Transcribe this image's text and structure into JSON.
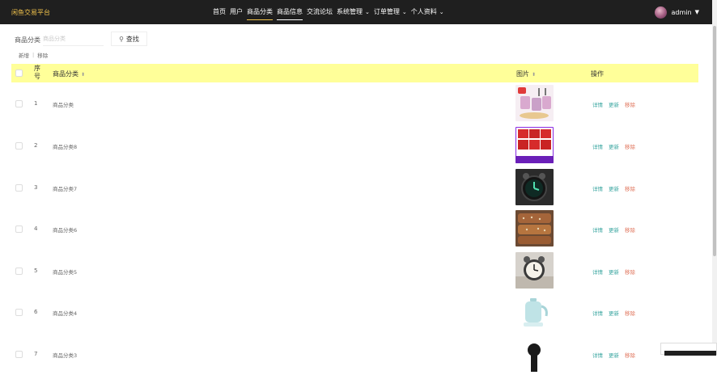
{
  "header": {
    "brand": "闲鱼交易平台",
    "menu": [
      {
        "label": "首页",
        "has_dropdown": false,
        "state": "normal"
      },
      {
        "label": "用户",
        "has_dropdown": false,
        "state": "normal"
      },
      {
        "label": "商品分类",
        "has_dropdown": false,
        "state": "active"
      },
      {
        "label": "商品信息",
        "has_dropdown": false,
        "state": "hover"
      },
      {
        "label": "交流论坛",
        "has_dropdown": false,
        "state": "normal"
      },
      {
        "label": "系统管理",
        "has_dropdown": true,
        "state": "normal"
      },
      {
        "label": "订单管理",
        "has_dropdown": true,
        "state": "normal"
      },
      {
        "label": "个人资料",
        "has_dropdown": true,
        "state": "normal"
      }
    ],
    "user": {
      "name": "admin",
      "caret": "▼"
    },
    "accent_color": "#f0c24b",
    "background_color": "#1f1f1f"
  },
  "search": {
    "label": "商品分类",
    "placeholder": "商品分类",
    "value": "",
    "button_label": "查找",
    "button_icon": "search-icon"
  },
  "toolbar": {
    "add_label": "新增",
    "delete_label": "移除"
  },
  "table": {
    "header_color": "#ffff99",
    "columns": {
      "index": "序号",
      "name": "商品分类",
      "image": "图片",
      "ops": "操作"
    },
    "rows": [
      {
        "index": "1",
        "name": "商品分类",
        "image": "pink-cups-set"
      },
      {
        "index": "2",
        "name": "商品分类8",
        "image": "red-milk-boxes"
      },
      {
        "index": "3",
        "name": "商品分类7",
        "image": "black-alarm-clock"
      },
      {
        "index": "4",
        "name": "商品分类6",
        "image": "baked-cakes"
      },
      {
        "index": "5",
        "name": "商品分类5",
        "image": "twin-bell-clock"
      },
      {
        "index": "6",
        "name": "商品分类4",
        "image": "blue-kettle"
      },
      {
        "index": "7",
        "name": "商品分类3",
        "image": "black-speaker"
      }
    ],
    "ops": {
      "detail": "详情",
      "edit": "更新",
      "delete": "移除"
    },
    "thumb_text_row2": "旺仔牛奶12支"
  }
}
